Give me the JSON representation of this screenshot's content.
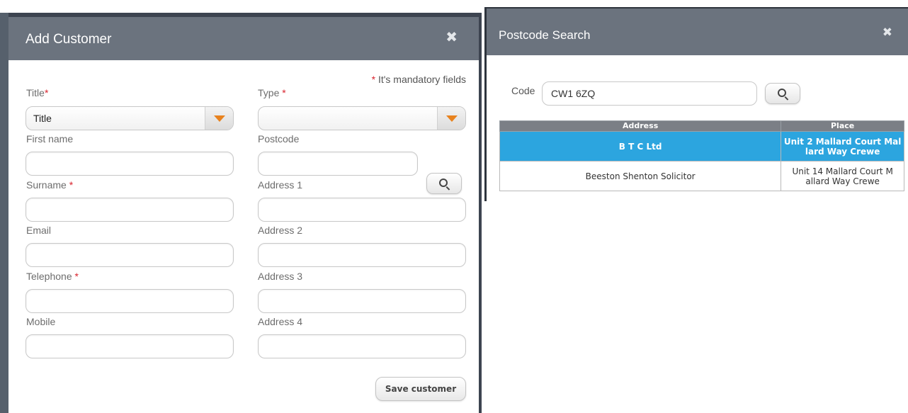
{
  "add_customer": {
    "title": "Add Customer",
    "close_glyph": "✖",
    "mandatory_star": "*",
    "mandatory_text": "It's mandatory fields",
    "labels": {
      "title": "Title",
      "type": "Type",
      "first_name": "First name",
      "postcode": "Postcode",
      "surname": "Surname",
      "address1": "Address 1",
      "email": "Email",
      "address2": "Address 2",
      "telephone": "Telephone",
      "address3": "Address 3",
      "mobile": "Mobile",
      "address4": "Address 4"
    },
    "required_marker": "*",
    "title_select_value": "Title",
    "type_select_value": "",
    "values": {
      "first_name": "",
      "postcode": "",
      "surname": "",
      "address1": "",
      "email": "",
      "address2": "",
      "telephone": "",
      "address3": "",
      "mobile": "",
      "address4": ""
    },
    "save_label": "Save customer",
    "colors": {
      "header": "#6b737e",
      "required": "#d9242e",
      "caret": "#e8821e"
    },
    "icons": {
      "close": "close-icon",
      "dropdown": "caret-down-icon",
      "search": "search-icon"
    }
  },
  "postcode_search": {
    "title": "Postcode Search",
    "close_glyph": "✖",
    "code_label": "Code",
    "code_value": "CW1 6ZQ",
    "columns": [
      "Address",
      "Place"
    ],
    "rows": [
      {
        "address": "B T C Ltd",
        "place": "Unit 2 Mallard Court Mal lard Way Crewe",
        "selected": true
      },
      {
        "address": "Beeston Shenton Solicitor",
        "place": "Unit 14 Mallard Court M allard Way Crewe",
        "selected": false
      }
    ],
    "colors": {
      "selected_row": "#2ca5df",
      "table_header": "#7b7f86"
    }
  }
}
